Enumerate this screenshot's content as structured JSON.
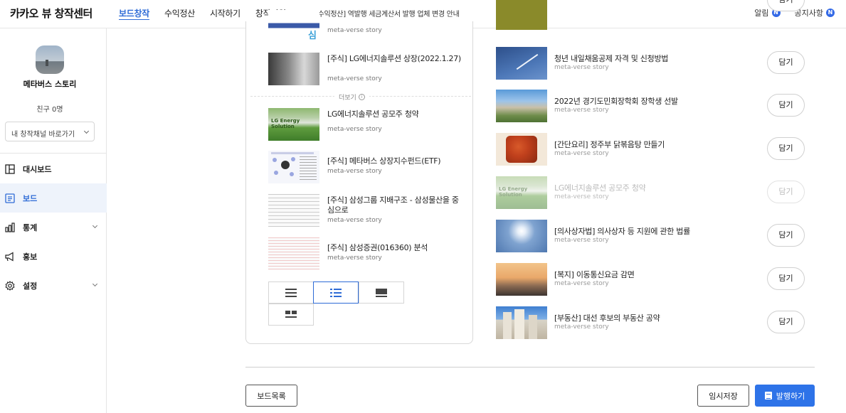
{
  "header": {
    "brand": "카카오 뷰 창작센터",
    "nav": [
      "보드창작",
      "수익정산",
      "시작하기",
      "창작지원"
    ],
    "notice": "[수익정산] 역발행 세금계산서 발행 업체 변경 안내",
    "alerts_label": "알림",
    "notices_label": "공지사항",
    "badge": "N"
  },
  "sidebar": {
    "channel_name": "메타버스 스토리",
    "friends": "친구 0명",
    "channel_select": "내 창작채널 바로가기",
    "menu": [
      {
        "label": "대시보드",
        "icon": "dashboard-icon"
      },
      {
        "label": "보드",
        "icon": "board-icon"
      },
      {
        "label": "통계",
        "icon": "stats-icon"
      },
      {
        "label": "홍보",
        "icon": "megaphone-icon"
      },
      {
        "label": "설정",
        "icon": "settings-icon"
      }
    ]
  },
  "selected_posts": [
    {
      "title": "",
      "source": "meta-verse story"
    },
    {
      "title": "[주식] LG에너지솔루션 상장(2022.1.27)",
      "source": "meta-verse story"
    },
    {
      "title": "LG에너지솔루션 공모주 청약",
      "source": "meta-verse story"
    },
    {
      "title": "[주식] 메타버스 상장지수펀드(ETF)",
      "source": "meta-verse story"
    },
    {
      "title": "[주식] 삼성그룹 지배구조 - 삼성물산을 중심으로",
      "source": "meta-verse story"
    },
    {
      "title": "[주식] 삼성증권(016360) 분석",
      "source": "meta-verse story"
    }
  ],
  "more_label": "더보기",
  "layout_options": [
    "list-layout-icon",
    "thumb-list-layout-icon",
    "card-layout-icon",
    "grid-layout-icon"
  ],
  "search_results": [
    {
      "title": "청년 내일채움공제 자격 및 신청방법",
      "source": "meta-verse story",
      "button": "담기"
    },
    {
      "title": "2022년 경기도민회장학회 장학생 선발",
      "source": "meta-verse story",
      "button": "담기"
    },
    {
      "title": "[간단요리] 정주부 닭볶음탕 만들기",
      "source": "meta-verse story",
      "button": "담기"
    },
    {
      "title": "LG에너지솔루션 공모주 청약",
      "source": "meta-verse story",
      "button": "담기"
    },
    {
      "title": "[의사상자법] 의사상자 등 지원에 관한 법률",
      "source": "meta-verse story",
      "button": "담기"
    },
    {
      "title": "[복지] 이동통신요금 감면",
      "source": "meta-verse story",
      "button": "담기"
    },
    {
      "title": "[부동산] 대선 후보의 부동산 공약",
      "source": "meta-verse story",
      "button": "담기"
    }
  ],
  "footer": {
    "board_list": "보드목록",
    "temp_save": "임시저장",
    "publish": "발행하기"
  }
}
